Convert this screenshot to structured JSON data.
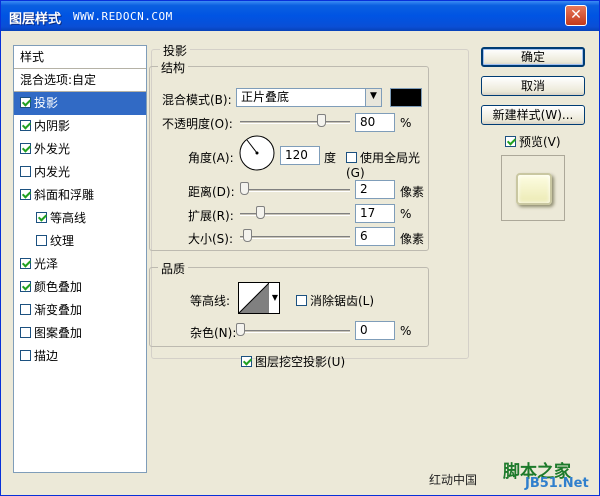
{
  "window": {
    "title": "图层样式",
    "watermark": "WWW.REDOCN.COM",
    "close_glyph": "✕"
  },
  "styles_panel": {
    "header": "样式",
    "blend_options": "混合选项:自定",
    "items": [
      {
        "label": "投影",
        "checked": true,
        "selected": true,
        "sub": false
      },
      {
        "label": "内阴影",
        "checked": true,
        "selected": false,
        "sub": false
      },
      {
        "label": "外发光",
        "checked": true,
        "selected": false,
        "sub": false
      },
      {
        "label": "内发光",
        "checked": false,
        "selected": false,
        "sub": false
      },
      {
        "label": "斜面和浮雕",
        "checked": true,
        "selected": false,
        "sub": false
      },
      {
        "label": "等高线",
        "checked": true,
        "selected": false,
        "sub": true
      },
      {
        "label": "纹理",
        "checked": false,
        "selected": false,
        "sub": true
      },
      {
        "label": "光泽",
        "checked": true,
        "selected": false,
        "sub": false
      },
      {
        "label": "颜色叠加",
        "checked": true,
        "selected": false,
        "sub": false
      },
      {
        "label": "渐变叠加",
        "checked": false,
        "selected": false,
        "sub": false
      },
      {
        "label": "图案叠加",
        "checked": false,
        "selected": false,
        "sub": false
      },
      {
        "label": "描边",
        "checked": false,
        "selected": false,
        "sub": false
      }
    ]
  },
  "drop_shadow": {
    "section_title": "投影",
    "structure": {
      "title": "结构",
      "blend_mode_label": "混合模式(B):",
      "blend_mode_value": "正片叠底",
      "blend_color": "#000000",
      "opacity_label": "不透明度(O):",
      "opacity_value": "80",
      "opacity_unit": "%",
      "angle_label": "角度(A):",
      "angle_value": "120",
      "angle_unit": "度",
      "global_light_label": "使用全局光(G)",
      "global_light_checked": false,
      "distance_label": "距离(D):",
      "distance_value": "2",
      "distance_unit": "像素",
      "spread_label": "扩展(R):",
      "spread_value": "17",
      "spread_unit": "%",
      "size_label": "大小(S):",
      "size_value": "6",
      "size_unit": "像素"
    },
    "quality": {
      "title": "品质",
      "contour_label": "等高线:",
      "antialias_label": "消除锯齿(L)",
      "antialias_checked": false,
      "noise_label": "杂色(N):",
      "noise_value": "0",
      "noise_unit": "%"
    },
    "knockout_label": "图层挖空投影(U)",
    "knockout_checked": true
  },
  "buttons": {
    "ok": "确定",
    "cancel": "取消",
    "new_style": "新建样式(W)...",
    "preview_label": "预览(V)",
    "preview_checked": true
  },
  "footer": {
    "text": "红动中国",
    "logo_top": "脚本之家",
    "logo_bottom": "JB51.Net"
  }
}
